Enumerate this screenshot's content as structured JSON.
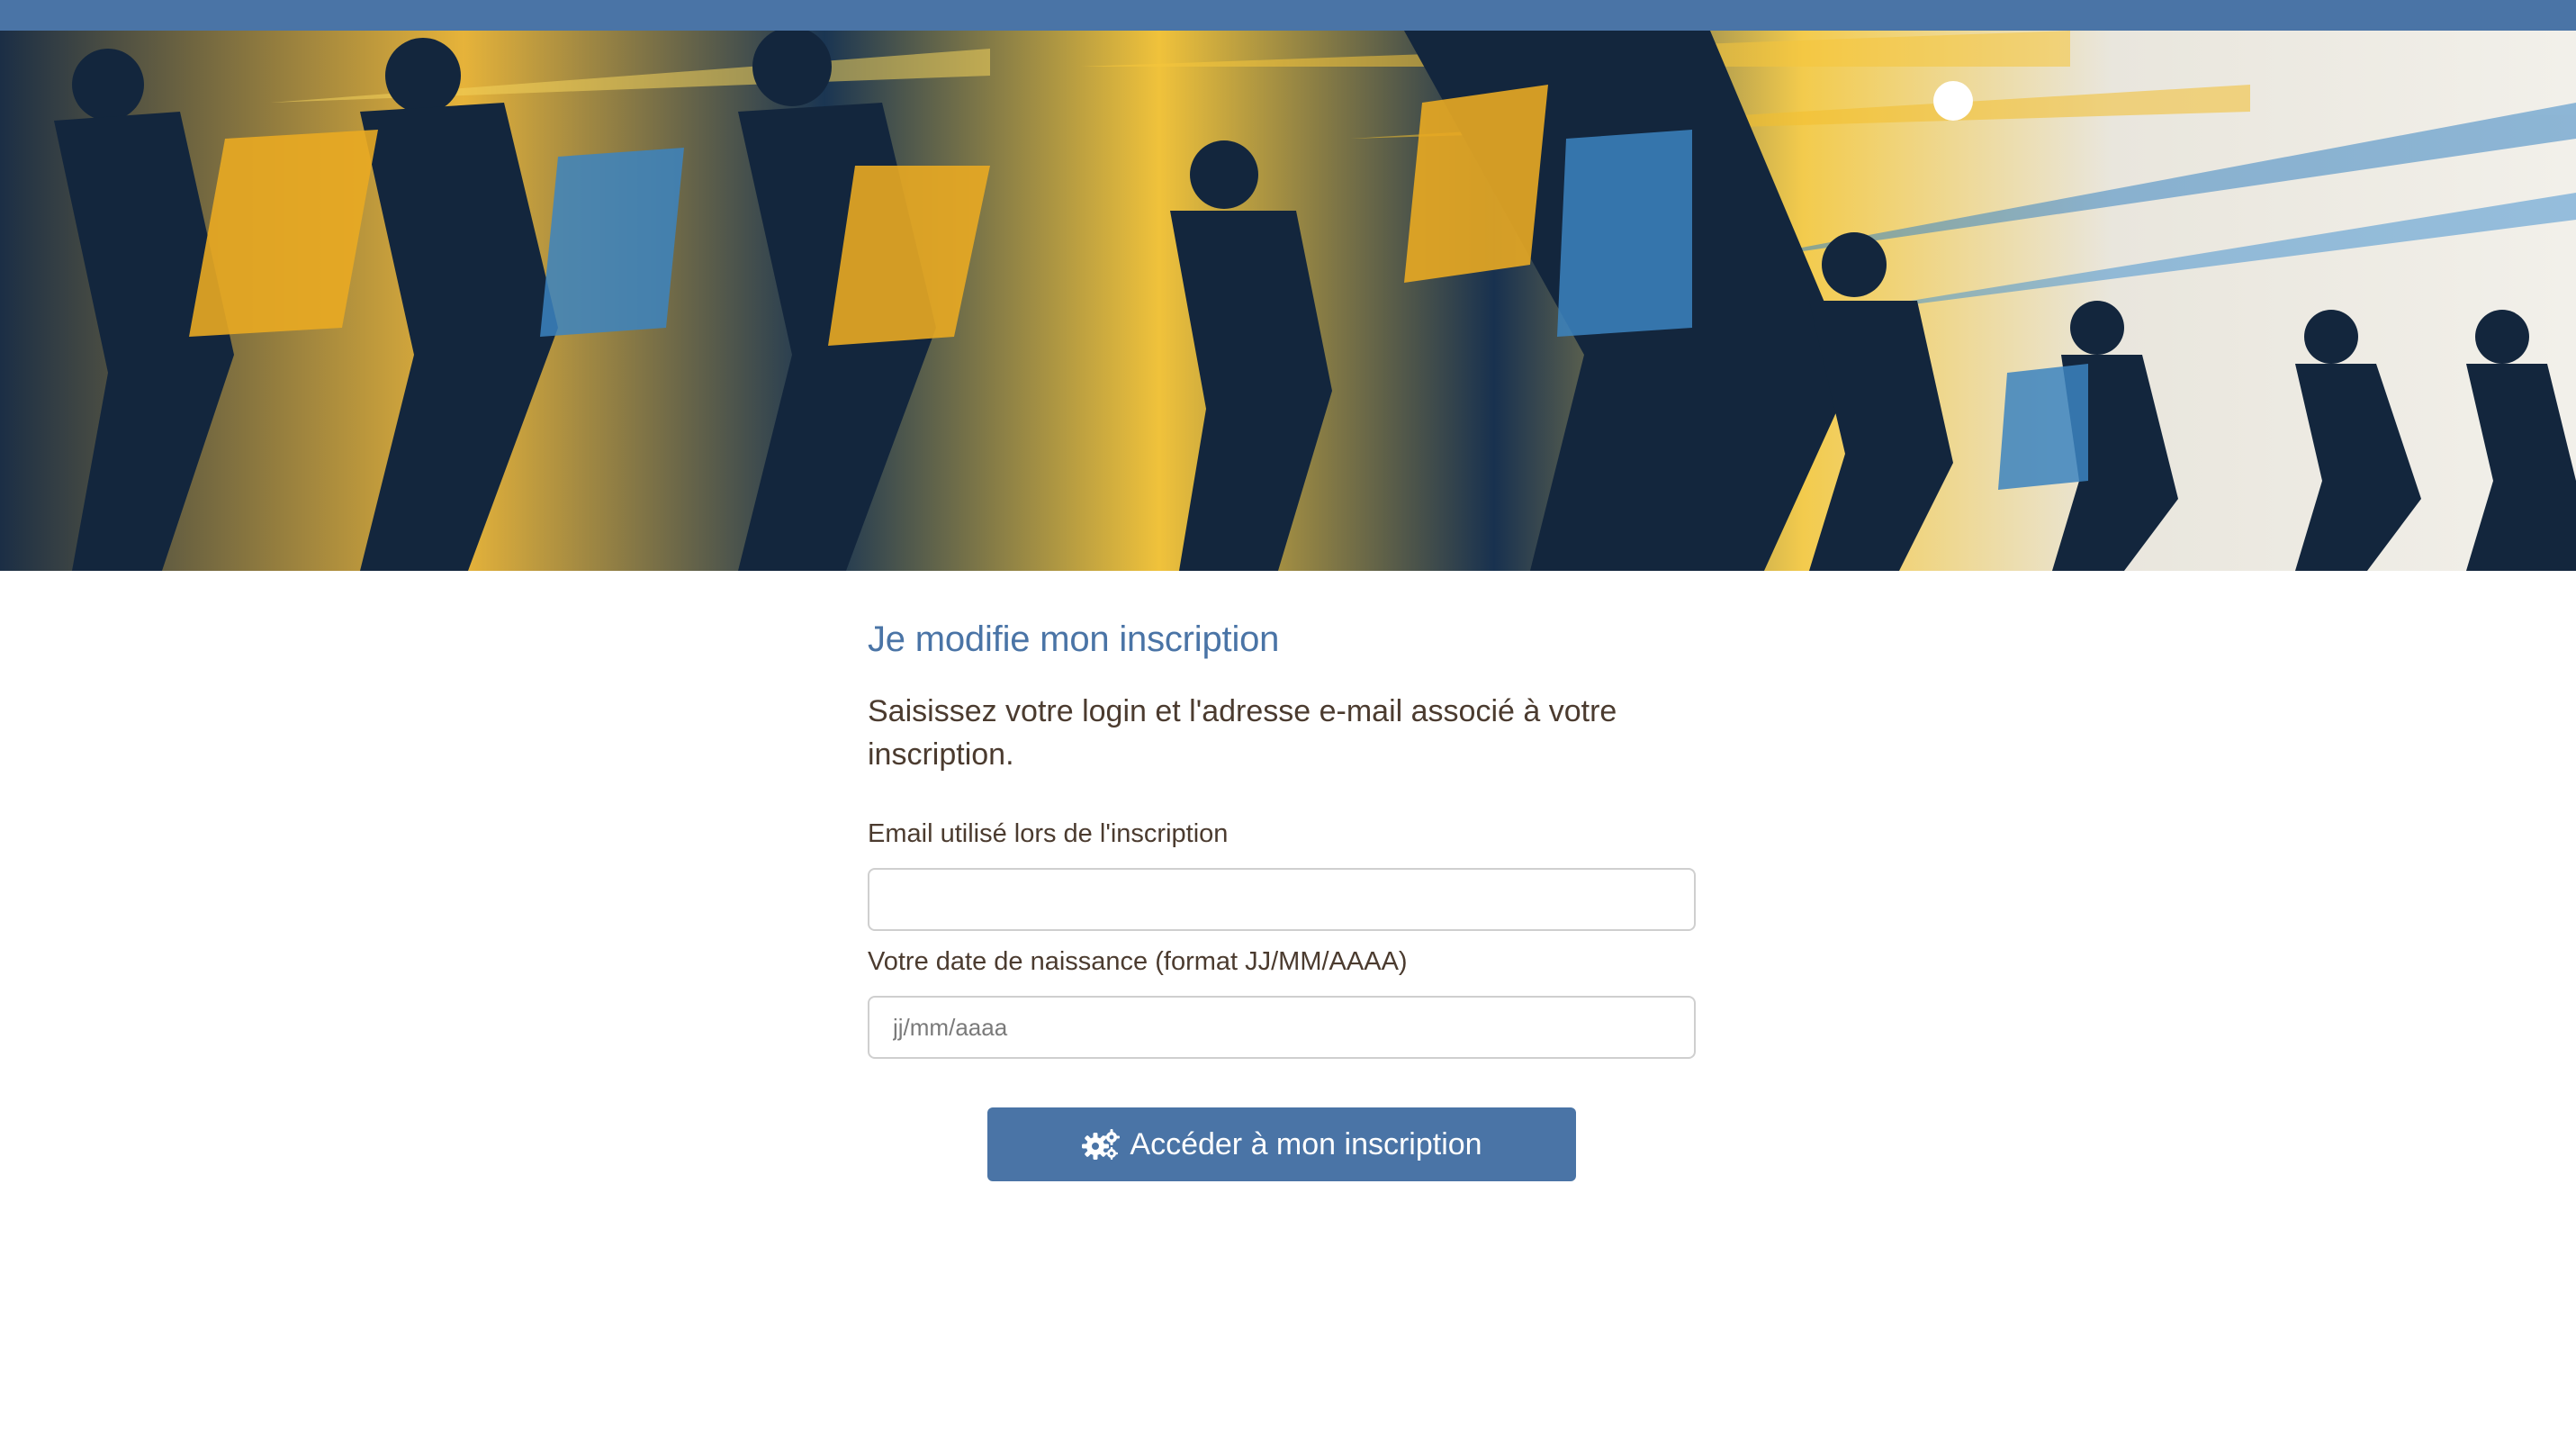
{
  "colors": {
    "brand": "#4a74a6",
    "text": "#4b3b2f",
    "border": "#cfcfcf"
  },
  "banner": {
    "image": "illustration-runners",
    "palette": [
      "#1b2e45",
      "#e6b33a",
      "#3b7fb8",
      "#f2f0ea"
    ]
  },
  "main": {
    "title": "Je modifie mon inscription",
    "intro": "Saisissez votre login et l'adresse e-mail associé à votre inscription.",
    "email": {
      "label": "Email utilisé lors de l'inscription",
      "value": "",
      "placeholder": ""
    },
    "birthdate": {
      "label": "Votre date de naissance (format JJ/MM/AAAA)",
      "value": "",
      "placeholder": "jj/mm/aaaa"
    },
    "submit": {
      "icon": "gears-icon",
      "label": "Accéder à mon inscription"
    }
  }
}
